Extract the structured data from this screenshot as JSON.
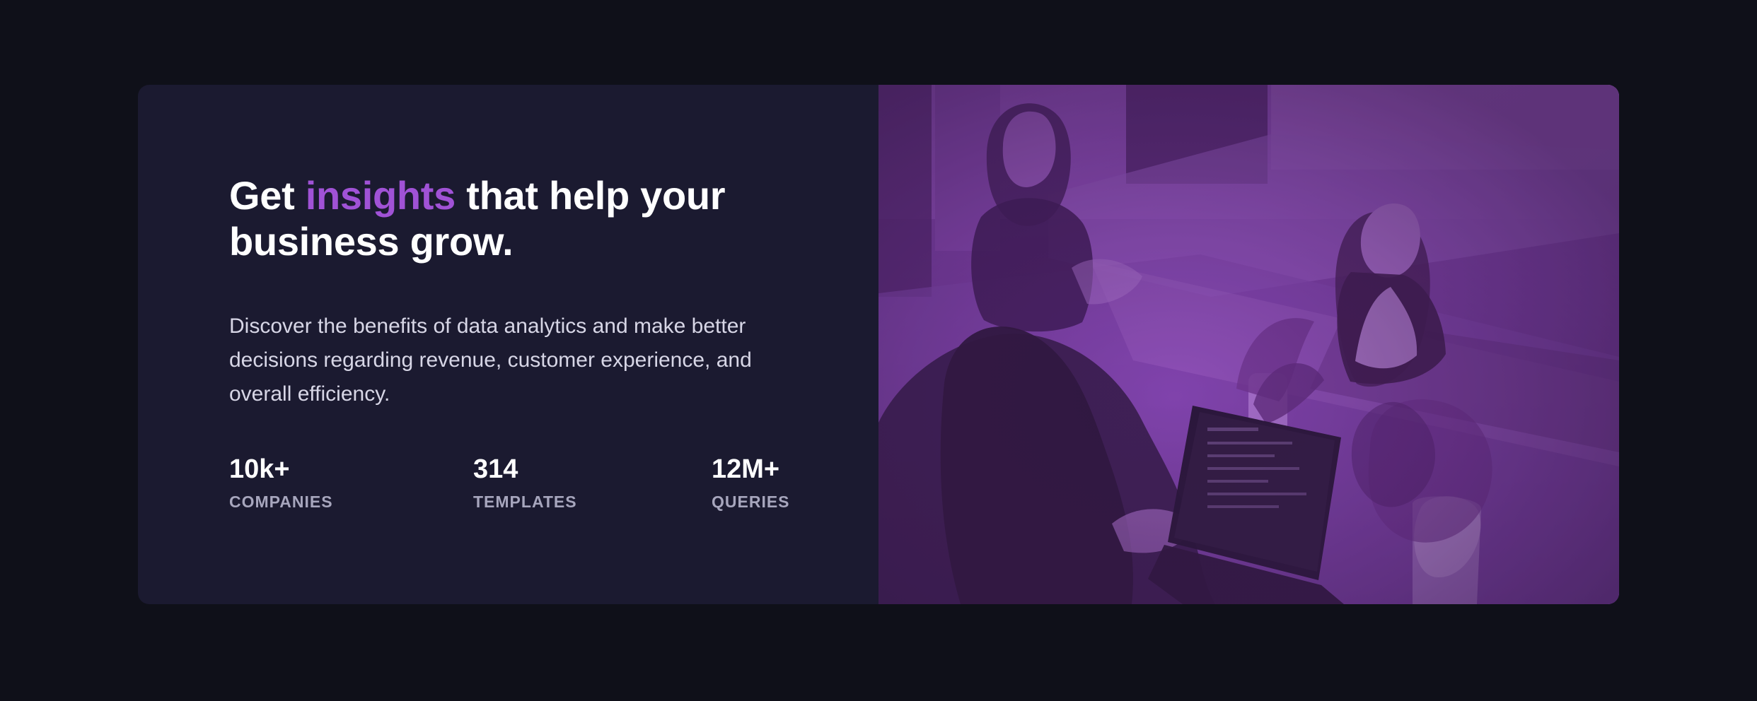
{
  "hero": {
    "headline_start": "Get ",
    "headline_accent": "insights",
    "headline_end": " that help your business grow.",
    "description": "Discover the benefits of data analytics and make better decisions regarding revenue, customer experience, and overall efficiency."
  },
  "stats": [
    {
      "value": "10k+",
      "label": "COMPANIES"
    },
    {
      "value": "314",
      "label": "TEMPLATES"
    },
    {
      "value": "12M+",
      "label": "QUERIES"
    }
  ],
  "colors": {
    "page_background": "#0f1019",
    "card_background": "#1b1a30",
    "accent": "#a052d6",
    "image_overlay": "#a052d6",
    "heading_text": "#ffffff",
    "body_text": "#d7d6e6",
    "label_text": "#a7a6bd"
  },
  "image": {
    "alt": "Three women working at a table with laptops"
  }
}
